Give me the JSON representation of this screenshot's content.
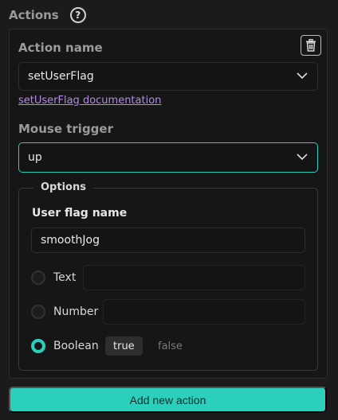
{
  "header": {
    "title": "Actions",
    "help_icon": "question-circle-icon"
  },
  "action": {
    "name_label": "Action name",
    "name_value": "setUserFlag",
    "doc_link": "setUserFlag documentation",
    "trigger_label": "Mouse trigger",
    "trigger_value": "up",
    "delete_icon": "trash-icon"
  },
  "options": {
    "legend": "Options",
    "flag_label": "User flag name",
    "flag_value": "smoothJog",
    "types": [
      {
        "label": "Text",
        "selected": false
      },
      {
        "label": "Number",
        "selected": false
      },
      {
        "label": "Boolean",
        "selected": true
      }
    ],
    "boolean_true": "true",
    "boolean_false": "false"
  },
  "footer": {
    "add_label": "Add new action"
  },
  "colors": {
    "accent": "#2ccfbb",
    "link": "#b18be6",
    "background": "#1b1b1b"
  }
}
